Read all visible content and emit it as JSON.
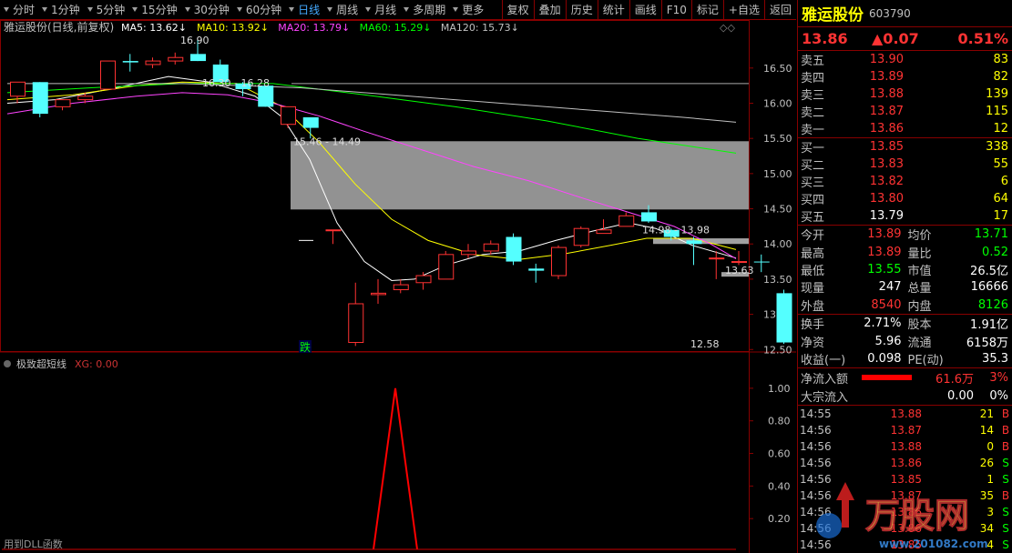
{
  "toolbar": {
    "left": [
      "分时",
      "1分钟",
      "5分钟",
      "15分钟",
      "30分钟",
      "60分钟",
      "日线",
      "周线",
      "月线",
      "多周期",
      "更多"
    ],
    "active": "日线",
    "right": [
      "复权",
      "叠加",
      "历史",
      "统计",
      "画线",
      "F10",
      "标记",
      "+自选",
      "返回"
    ]
  },
  "chart": {
    "title": "雅运股份(日线,前复权)",
    "ma": [
      {
        "label": "MA5: 13.62",
        "color": "#ffffff",
        "arrow": "down"
      },
      {
        "label": "MA10: 13.92",
        "color": "#ffff00",
        "arrow": "down"
      },
      {
        "label": "MA20: 13.79",
        "color": "#ff44ff",
        "arrow": "down"
      },
      {
        "label": "MA60: 15.29",
        "color": "#00ff00",
        "arrow": "down"
      },
      {
        "label": "MA120: 15.73",
        "color": "#c0c0c0",
        "arrow": "down"
      }
    ],
    "y_ticks": [
      "16.50",
      "16.00",
      "15.50",
      "15.00",
      "14.50",
      "14.00",
      "13.50",
      "13.00",
      "12.50"
    ],
    "y_range": [
      12.4,
      16.95
    ],
    "annotations": [
      {
        "text": "16.90",
        "price": 16.9,
        "x": 198
      },
      {
        "text": "16.30 - 16.28",
        "price": 16.29,
        "x": 222
      },
      {
        "text": "15.46 - 14.49",
        "price": 15.46,
        "x": 322
      },
      {
        "text": "14.98 - 13.98",
        "price": 14.2,
        "x": 705
      },
      {
        "text": "13.63",
        "price": 13.63,
        "x": 796
      },
      {
        "text": "12.58",
        "price": 12.58,
        "x": 758
      }
    ],
    "zones": [
      {
        "from": 15.46,
        "to": 14.49,
        "x0": 319,
        "x1": 822,
        "color": "#9a9a9a"
      },
      {
        "from": 14.08,
        "to": 14.0,
        "x0": 717,
        "x1": 822,
        "color": "#aaaaaa"
      },
      {
        "from": 13.6,
        "to": 13.54,
        "x0": 792,
        "x1": 822,
        "color": "#aaaaaa"
      }
    ],
    "marker_text": "跌",
    "candles": [
      {
        "o": 16.1,
        "h": 16.3,
        "l": 16.0,
        "c": 16.3
      },
      {
        "o": 16.3,
        "h": 16.3,
        "l": 15.8,
        "c": 15.85
      },
      {
        "o": 15.95,
        "h": 16.05,
        "l": 15.9,
        "c": 16.05
      },
      {
        "o": 16.05,
        "h": 16.15,
        "l": 16.0,
        "c": 16.1
      },
      {
        "o": 16.2,
        "h": 16.6,
        "l": 16.2,
        "c": 16.6
      },
      {
        "o": 16.6,
        "h": 16.7,
        "l": 16.45,
        "c": 16.58
      },
      {
        "o": 16.55,
        "h": 16.65,
        "l": 16.5,
        "c": 16.6
      },
      {
        "o": 16.6,
        "h": 16.72,
        "l": 16.55,
        "c": 16.65
      },
      {
        "o": 16.7,
        "h": 16.9,
        "l": 16.6,
        "c": 16.6
      },
      {
        "o": 16.55,
        "h": 16.62,
        "l": 16.3,
        "c": 16.3
      },
      {
        "o": 16.28,
        "h": 16.3,
        "l": 16.1,
        "c": 16.2
      },
      {
        "o": 16.25,
        "h": 16.25,
        "l": 15.95,
        "c": 15.95
      },
      {
        "o": 15.7,
        "h": 15.95,
        "l": 15.65,
        "c": 15.95
      },
      {
        "o": 15.8,
        "h": 15.8,
        "l": 15.5,
        "c": 15.65
      },
      {
        "o": 14.2,
        "h": 14.2,
        "l": 14.0,
        "c": 14.2
      },
      {
        "o": 12.6,
        "h": 13.45,
        "l": 12.55,
        "c": 13.15
      },
      {
        "o": 13.28,
        "h": 13.5,
        "l": 13.15,
        "c": 13.3
      },
      {
        "o": 13.35,
        "h": 13.5,
        "l": 13.3,
        "c": 13.42
      },
      {
        "o": 13.45,
        "h": 13.6,
        "l": 13.35,
        "c": 13.55
      },
      {
        "o": 13.5,
        "h": 13.9,
        "l": 13.5,
        "c": 13.85
      },
      {
        "o": 13.85,
        "h": 14.0,
        "l": 13.8,
        "c": 13.9
      },
      {
        "o": 13.9,
        "h": 14.05,
        "l": 13.85,
        "c": 14.0
      },
      {
        "o": 14.1,
        "h": 14.15,
        "l": 13.7,
        "c": 13.75
      },
      {
        "o": 13.65,
        "h": 13.72,
        "l": 13.45,
        "c": 13.62
      },
      {
        "o": 13.55,
        "h": 13.98,
        "l": 13.5,
        "c": 13.95
      },
      {
        "o": 13.98,
        "h": 14.25,
        "l": 13.95,
        "c": 14.22
      },
      {
        "o": 14.15,
        "h": 14.35,
        "l": 14.15,
        "c": 14.2
      },
      {
        "o": 14.25,
        "h": 14.45,
        "l": 14.25,
        "c": 14.4
      },
      {
        "o": 14.45,
        "h": 14.55,
        "l": 14.3,
        "c": 14.32
      },
      {
        "o": 14.2,
        "h": 14.22,
        "l": 14.05,
        "c": 14.1
      },
      {
        "o": 14.05,
        "h": 14.1,
        "l": 13.7,
        "c": 14.0
      },
      {
        "o": 13.8,
        "h": 13.9,
        "l": 13.5,
        "c": 13.8
      },
      {
        "o": 13.75,
        "h": 13.9,
        "l": 13.7,
        "c": 13.75
      },
      {
        "o": 13.75,
        "h": 13.85,
        "l": 13.6,
        "c": 13.74
      },
      {
        "o": 13.3,
        "h": 13.35,
        "l": 12.58,
        "c": 12.6
      }
    ],
    "ma_lines": [
      {
        "color": "#ffffff",
        "pts": [
          [
            8,
            16.0
          ],
          [
            60,
            16.05
          ],
          [
            120,
            16.2
          ],
          [
            185,
            16.38
          ],
          [
            230,
            16.3
          ],
          [
            280,
            16.1
          ],
          [
            310,
            15.8
          ],
          [
            340,
            15.2
          ],
          [
            370,
            14.3
          ],
          [
            400,
            13.75
          ],
          [
            430,
            13.48
          ],
          [
            455,
            13.5
          ],
          [
            490,
            13.7
          ],
          [
            530,
            13.85
          ],
          [
            570,
            13.9
          ],
          [
            610,
            14.05
          ],
          [
            650,
            14.18
          ],
          [
            690,
            14.3
          ],
          [
            720,
            14.22
          ],
          [
            760,
            13.98
          ],
          [
            808,
            13.8
          ]
        ]
      },
      {
        "color": "#ffff00",
        "pts": [
          [
            8,
            16.05
          ],
          [
            80,
            16.12
          ],
          [
            150,
            16.25
          ],
          [
            200,
            16.3
          ],
          [
            260,
            16.28
          ],
          [
            310,
            15.95
          ],
          [
            350,
            15.45
          ],
          [
            390,
            14.85
          ],
          [
            430,
            14.35
          ],
          [
            470,
            14.05
          ],
          [
            520,
            13.85
          ],
          [
            570,
            13.78
          ],
          [
            620,
            13.86
          ],
          [
            670,
            13.98
          ],
          [
            710,
            14.08
          ],
          [
            760,
            14.08
          ],
          [
            808,
            13.92
          ]
        ]
      },
      {
        "color": "#ff44ff",
        "pts": [
          [
            8,
            15.85
          ],
          [
            80,
            16.0
          ],
          [
            150,
            16.1
          ],
          [
            200,
            16.15
          ],
          [
            250,
            16.12
          ],
          [
            300,
            16.0
          ],
          [
            350,
            15.82
          ],
          [
            400,
            15.6
          ],
          [
            460,
            15.35
          ],
          [
            520,
            15.1
          ],
          [
            580,
            14.9
          ],
          [
            640,
            14.65
          ],
          [
            690,
            14.45
          ],
          [
            740,
            14.25
          ],
          [
            780,
            14.0
          ],
          [
            808,
            13.79
          ]
        ]
      },
      {
        "color": "#00ff00",
        "pts": [
          [
            8,
            16.15
          ],
          [
            100,
            16.22
          ],
          [
            200,
            16.28
          ],
          [
            300,
            16.28
          ],
          [
            400,
            16.12
          ],
          [
            500,
            15.95
          ],
          [
            600,
            15.75
          ],
          [
            700,
            15.5
          ],
          [
            808,
            15.29
          ]
        ]
      },
      {
        "color": "#c0c0c0",
        "pts": [
          [
            8,
            16.28
          ],
          [
            200,
            16.28
          ],
          [
            330,
            16.22
          ],
          [
            450,
            16.1
          ],
          [
            550,
            16.0
          ],
          [
            650,
            15.9
          ],
          [
            750,
            15.8
          ],
          [
            808,
            15.73
          ]
        ]
      }
    ],
    "x_start": 11,
    "x_step": 24.75,
    "ind_title": "极致超短线",
    "ind_xg": "XG: 0.00",
    "ind_ticks": [
      "1.00",
      "0.80",
      "0.60",
      "0.40",
      "0.20"
    ],
    "ind_spike_at": 434,
    "footer": "用到DLL函数"
  },
  "quote": {
    "name": "雅运股份",
    "code": "603790",
    "price": "13.86",
    "change": "▲0.07",
    "pct": "0.51%",
    "sell": [
      {
        "label": "卖五",
        "price": "13.90",
        "vol": "83"
      },
      {
        "label": "卖四",
        "price": "13.89",
        "vol": "82"
      },
      {
        "label": "卖三",
        "price": "13.88",
        "vol": "139"
      },
      {
        "label": "卖二",
        "price": "13.87",
        "vol": "115"
      },
      {
        "label": "卖一",
        "price": "13.86",
        "vol": "12"
      }
    ],
    "buy": [
      {
        "label": "买一",
        "price": "13.85",
        "vol": "338"
      },
      {
        "label": "买二",
        "price": "13.83",
        "vol": "55"
      },
      {
        "label": "买三",
        "price": "13.82",
        "vol": "6"
      },
      {
        "label": "买四",
        "price": "13.80",
        "vol": "64"
      },
      {
        "label": "买五",
        "price": "13.79",
        "vol": "17"
      }
    ],
    "stats": [
      {
        "k": "今开",
        "v": "13.89",
        "c": "red"
      },
      {
        "k": "均价",
        "v": "13.71",
        "c": "grn"
      },
      {
        "k": "最高",
        "v": "13.89",
        "c": "red"
      },
      {
        "k": "量比",
        "v": "0.52",
        "c": "grn"
      },
      {
        "k": "最低",
        "v": "13.55",
        "c": "grn"
      },
      {
        "k": "市值",
        "v": "26.5亿",
        "c": "wht"
      },
      {
        "k": "现量",
        "v": "247",
        "c": "wht"
      },
      {
        "k": "总量",
        "v": "16666",
        "c": "wht"
      },
      {
        "k": "外盘",
        "v": "8540",
        "c": "red"
      },
      {
        "k": "内盘",
        "v": "8126",
        "c": "grn"
      }
    ],
    "stats2": [
      {
        "k": "换手",
        "v": "2.71%",
        "c": "wht"
      },
      {
        "k": "股本",
        "v": "1.91亿",
        "c": "wht"
      },
      {
        "k": "净资",
        "v": "5.96",
        "c": "wht"
      },
      {
        "k": "流通",
        "v": "6158万",
        "c": "wht"
      },
      {
        "k": "收益(一)",
        "v": "0.098",
        "c": "wht"
      },
      {
        "k": "PE(动)",
        "v": "35.3",
        "c": "wht"
      }
    ],
    "flow": [
      {
        "k": "净流入额",
        "v": "61.6万",
        "pct": "3%",
        "bar": true
      },
      {
        "k": "大宗流入",
        "v": "0.00",
        "pct": "0%",
        "bar": false
      }
    ],
    "ticks": [
      {
        "t": "14:55",
        "p": "13.88",
        "v": "21",
        "s": "B"
      },
      {
        "t": "14:56",
        "p": "13.87",
        "v": "14",
        "s": "B"
      },
      {
        "t": "14:56",
        "p": "13.88",
        "v": "0",
        "s": "B"
      },
      {
        "t": "14:56",
        "p": "13.86",
        "v": "26",
        "s": "S"
      },
      {
        "t": "14:56",
        "p": "13.85",
        "v": "1",
        "s": "S"
      },
      {
        "t": "14:56",
        "p": "13.87",
        "v": "35",
        "s": "B"
      },
      {
        "t": "14:56",
        "p": "13.86",
        "v": "3",
        "s": "S"
      },
      {
        "t": "14:56",
        "p": "13.86",
        "v": "34",
        "s": "S"
      },
      {
        "t": "14:56",
        "p": "13.85",
        "v": "4",
        "s": "S"
      }
    ],
    "watermark": "万股网",
    "watermark_url": "www.201082.com"
  }
}
